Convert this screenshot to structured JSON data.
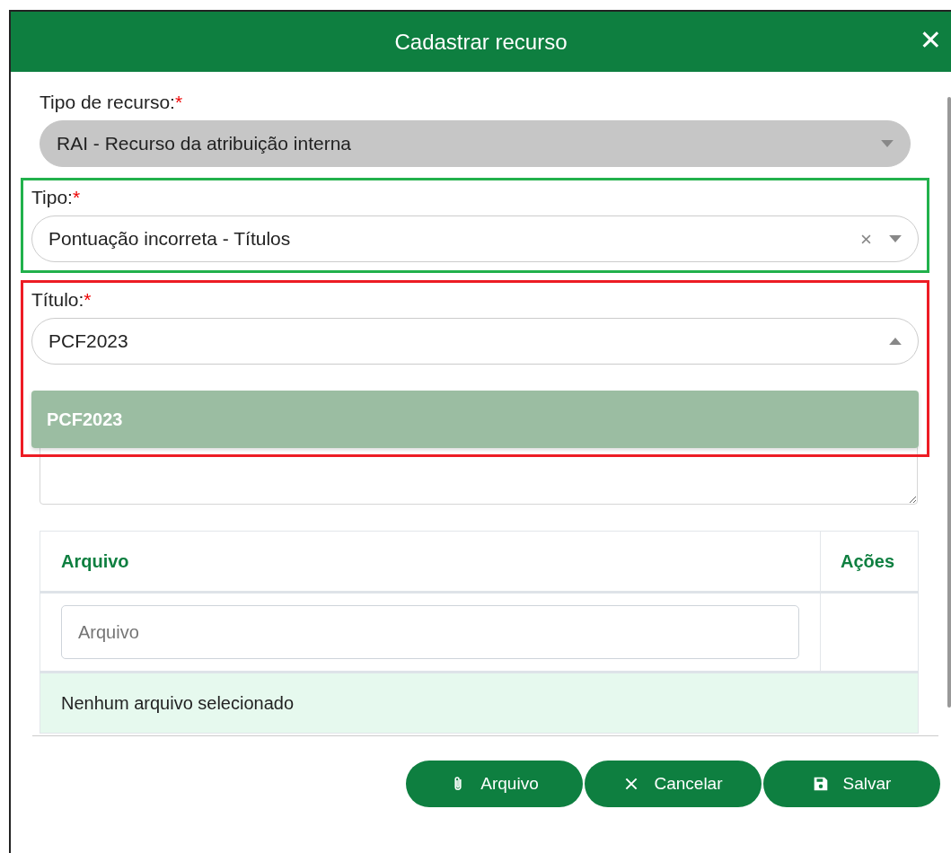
{
  "dialog": {
    "title": "Cadastrar recurso",
    "close": "✕"
  },
  "fields": [
    {
      "kind": "select",
      "label": "Tipo de recurso:",
      "required": "*",
      "value": "RAI - Recurso da atribuição interna",
      "disabled": true,
      "clearable": false,
      "expanded": false
    },
    {
      "kind": "select",
      "label": "Tipo:",
      "required": "*",
      "value": "Pontuação incorreta - Títulos",
      "disabled": false,
      "clearable": true,
      "expanded": false,
      "outline": {
        "color": "#22b14c"
      }
    },
    {
      "kind": "select",
      "label": "Título:",
      "required": "*",
      "value": "PCF2023",
      "disabled": false,
      "clearable": false,
      "expanded": true,
      "outline": {
        "color": "#ed1c24"
      },
      "options": [
        {
          "label": "PCF2023",
          "selected": true
        }
      ]
    },
    {
      "kind": "textarea"
    }
  ],
  "table": {
    "columns": [
      "Arquivo",
      "Ações"
    ],
    "rows": [
      {
        "input": {
          "placeholder": "Arquivo"
        }
      }
    ],
    "empty_message": "Nenhum arquivo selecionado"
  },
  "buttons": [
    {
      "kind": "attach",
      "label": "Arquivo"
    },
    {
      "kind": "cancel",
      "label": "Cancelar"
    },
    {
      "kind": "save",
      "label": "Salvar"
    }
  ]
}
